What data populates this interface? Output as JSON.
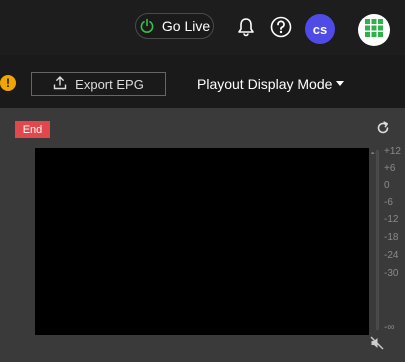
{
  "header": {
    "go_live_label": "Go Live",
    "avatar_initials": "cs",
    "icons": [
      "power-icon",
      "bell-icon",
      "help-icon",
      "apps-grid-icon"
    ],
    "colors": {
      "avatar": "#4f4be6",
      "power": "#33c24a",
      "apps_grid": "#2fb24a"
    }
  },
  "toolbar": {
    "warning_symbol": "!",
    "export_label": "Export EPG",
    "mode_label": "Playout Display Mode"
  },
  "player": {
    "status_badge": "End",
    "status_color": "#e0484c",
    "level_readout": "--",
    "meter_ticks": [
      "+12",
      "+6",
      "0",
      "-6",
      "-12",
      "-18",
      "-24",
      "-30",
      "-∞"
    ]
  }
}
